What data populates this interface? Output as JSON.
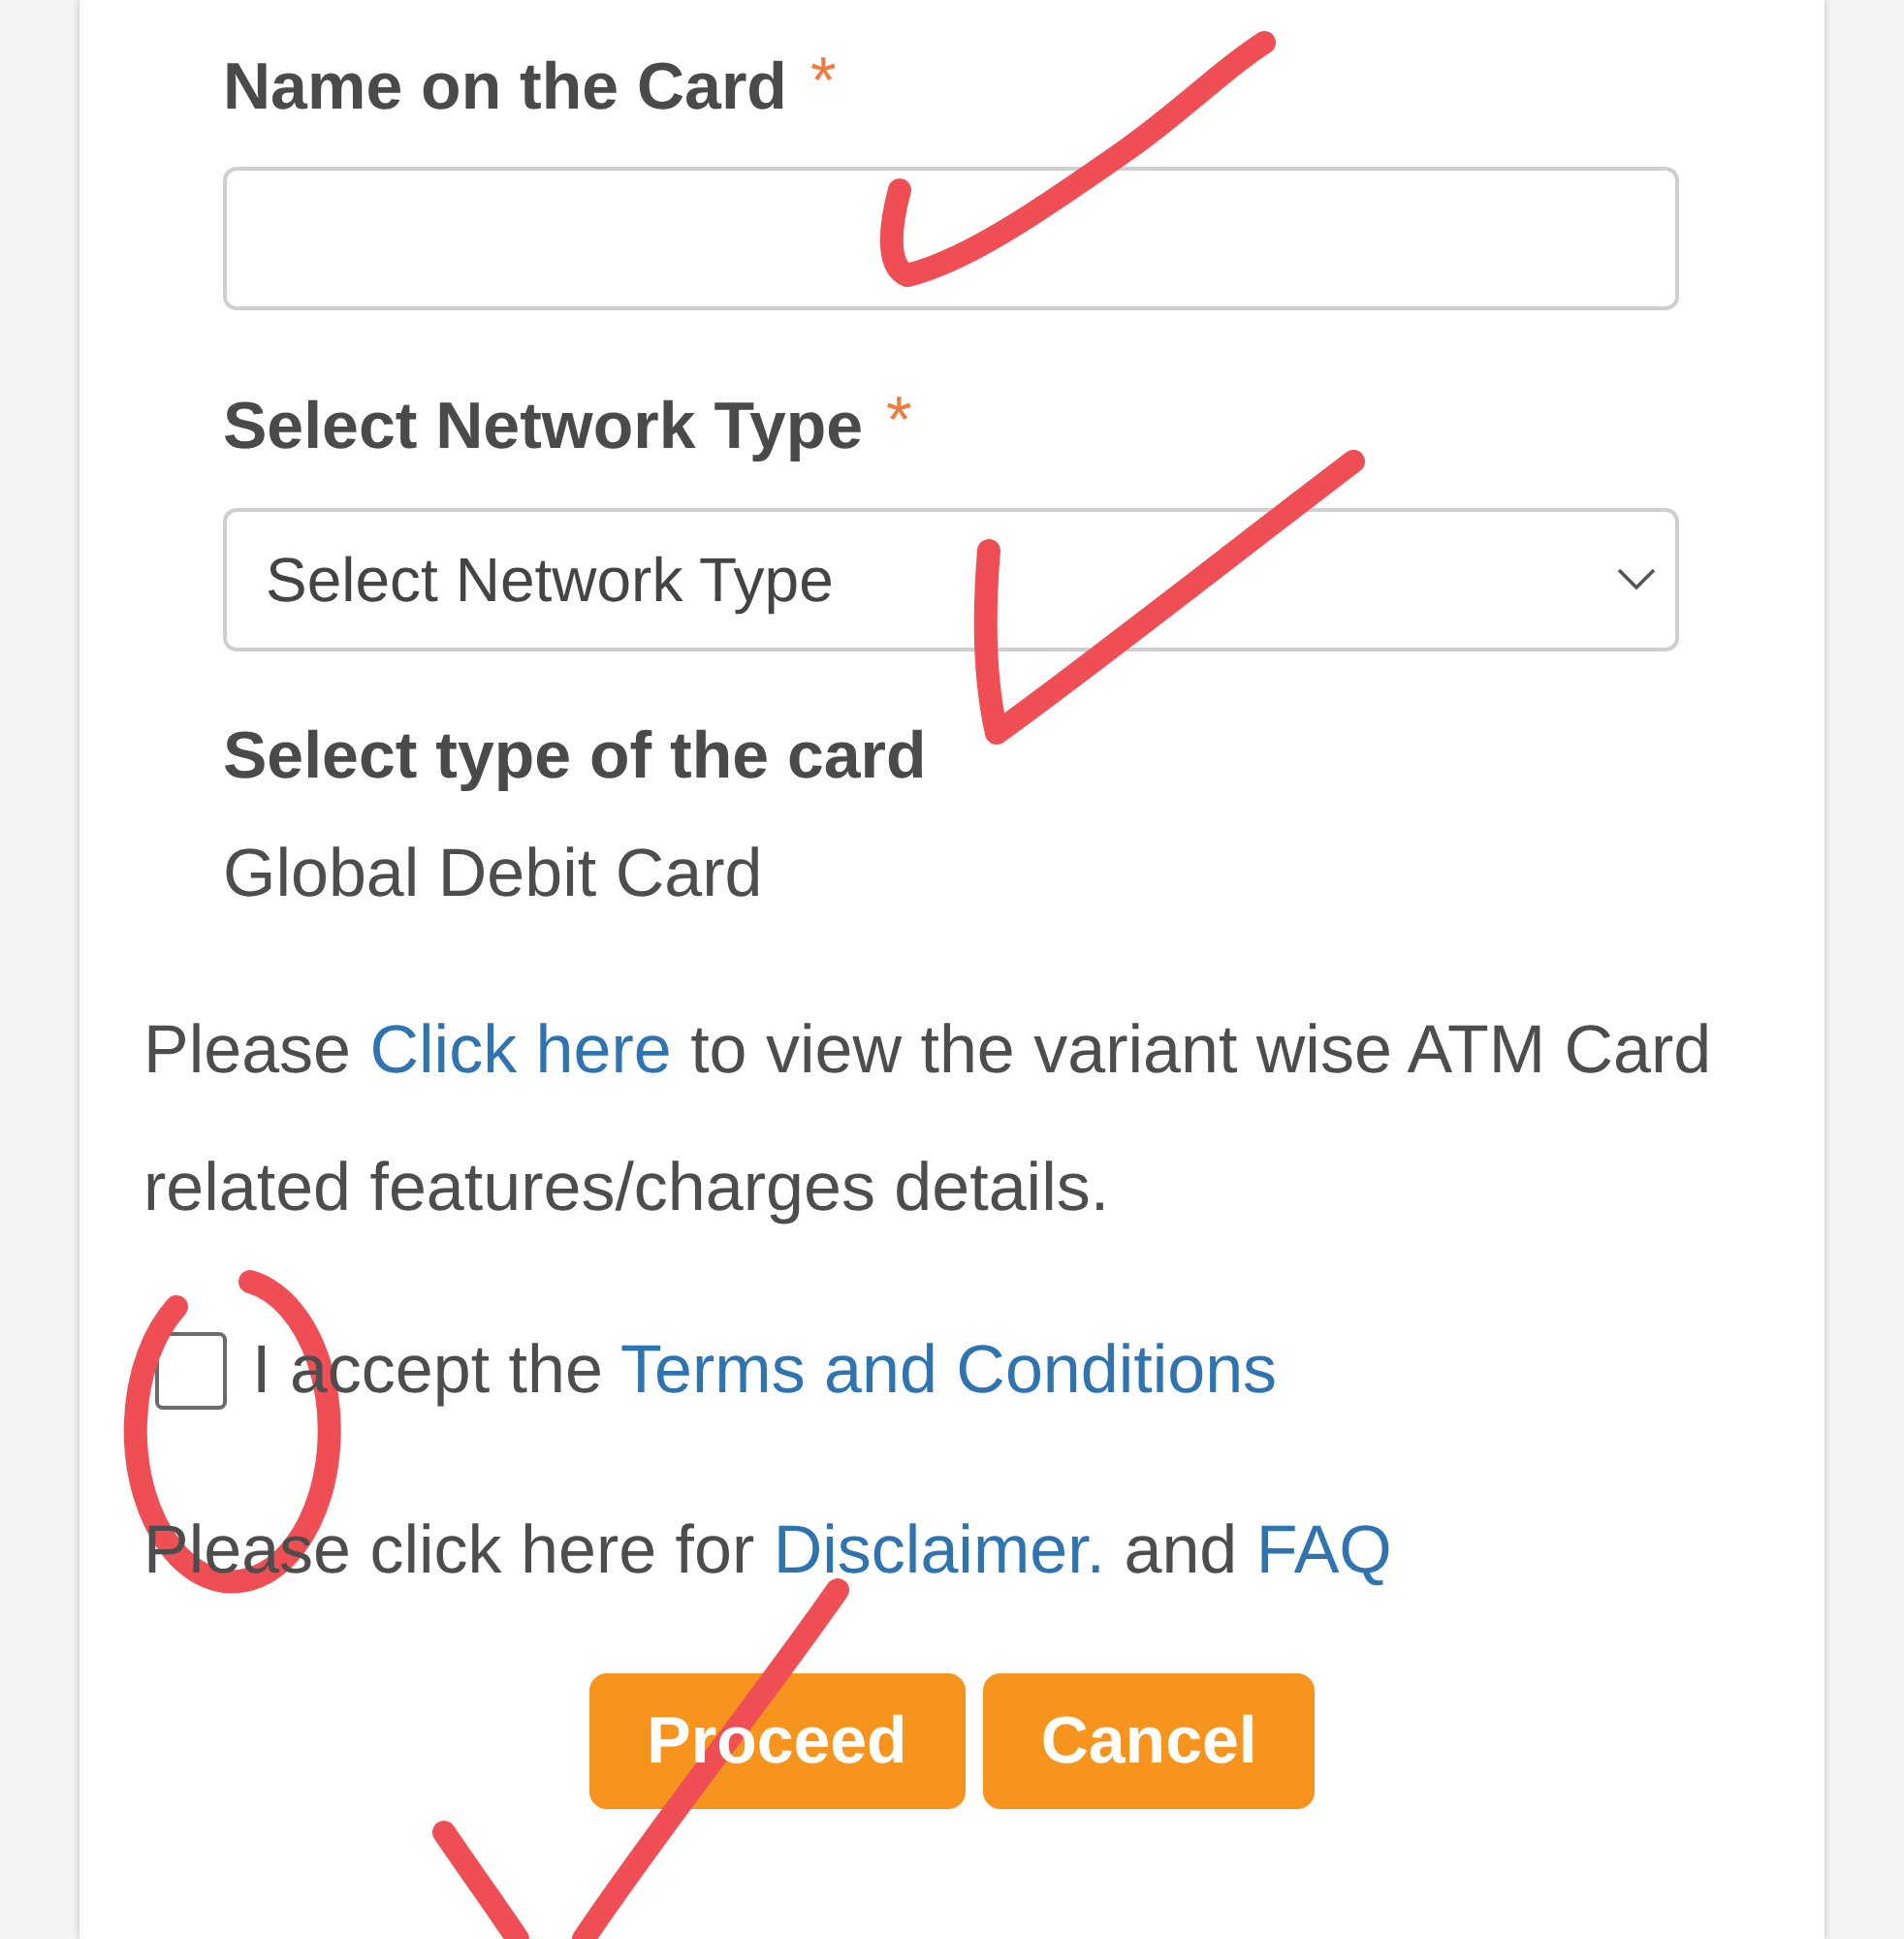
{
  "form": {
    "fields": [
      {
        "kind": "text",
        "label": "Name on the Card",
        "required_mark": "*"
      },
      {
        "kind": "select",
        "label": "Select Network Type",
        "required_mark": "*",
        "placeholder": "Select Network Type"
      }
    ],
    "card_type": {
      "label": "Select type of the card",
      "value": "Global Debit Card"
    }
  },
  "variant_note": [
    {
      "kind": "text",
      "text": "Please "
    },
    {
      "kind": "link",
      "text": "Click here"
    },
    {
      "kind": "text",
      "text": " to view the variant wise ATM Card related features/charges details."
    }
  ],
  "terms": {
    "checked": false,
    "parts": [
      {
        "kind": "text",
        "text": "I accept the "
      },
      {
        "kind": "link",
        "text": "Terms and Conditions"
      }
    ]
  },
  "disclaimer": [
    {
      "kind": "text",
      "text": "Please click here for "
    },
    {
      "kind": "link",
      "text": "Disclaimer."
    },
    {
      "kind": "text",
      "text": " and "
    },
    {
      "kind": "link",
      "text": "FAQ"
    }
  ],
  "buttons": [
    {
      "label": "Proceed"
    },
    {
      "label": "Cancel"
    }
  ],
  "annotations": [
    {
      "kind": "check"
    },
    {
      "kind": "check"
    },
    {
      "kind": "circle"
    },
    {
      "kind": "check"
    }
  ]
}
